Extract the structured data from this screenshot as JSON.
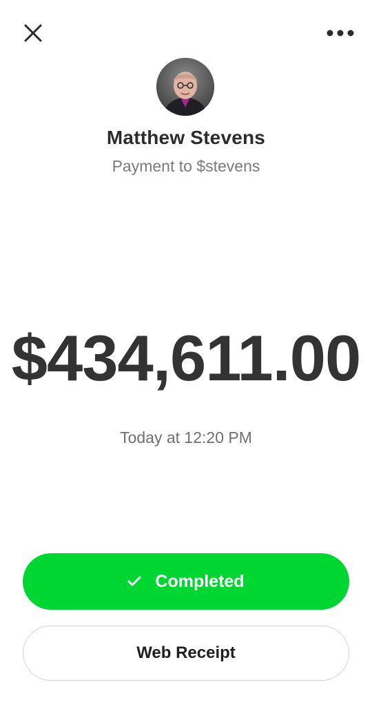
{
  "header": {
    "close_icon": "close-icon",
    "more_icon": "more-horizontal-icon"
  },
  "recipient": {
    "avatar_icon": "profile-photo",
    "name": "Matthew Stevens",
    "subtitle": "Payment to $stevens"
  },
  "payment": {
    "amount": "$434,611.00",
    "timestamp": "Today at 12:20 PM"
  },
  "actions": {
    "status_label": "Completed",
    "status_icon": "checkmark-icon",
    "receipt_label": "Web Receipt"
  },
  "colors": {
    "accent_green": "#00d632",
    "text_dark": "#2c2c2c",
    "text_muted": "#7a7a7a"
  }
}
